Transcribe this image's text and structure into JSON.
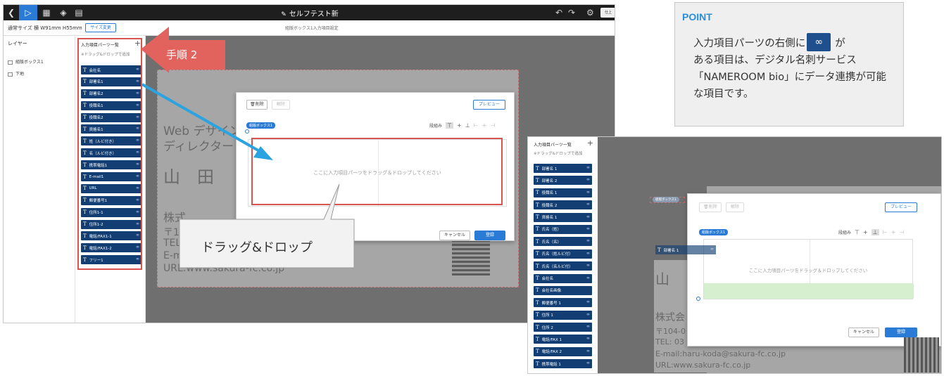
{
  "topbar": {
    "back_icon": "chevron-left-icon",
    "title": "セルフテスト新",
    "mini_button": "仕上"
  },
  "subbar": {
    "size_label": "通常サイズ 横 W91mm H55mm",
    "size_change_button": "サイズ変更",
    "center_title": "組版ボックス1入力項目設定"
  },
  "layers": {
    "title": "レイヤー",
    "items": [
      "組版ボックス1",
      "下地"
    ]
  },
  "parts_panel": {
    "title": "入力項目パーツ一覧",
    "hint": "※ドラッグ&ドロップで追加",
    "items": [
      "会社名",
      "部署名1",
      "部署名2",
      "役職名1",
      "役職名2",
      "資格名1",
      "姓（ルビ付き）",
      "名（ルビ付き）",
      "携帯電話1",
      "E-mail1",
      "URL",
      "郵便番号1",
      "住所1-1",
      "住所1-2",
      "電話/FAX1-1",
      "電話/FAX1-2",
      "フリー1"
    ]
  },
  "card1": {
    "line1": "Web デザイン",
    "line2": "ディレクター",
    "name": "山　田",
    "company": "株式",
    "zip": "〒1",
    "tel": "TEL",
    "email": "E-m",
    "url": "URL:www.sakura-fc.co.jp"
  },
  "modal1": {
    "delete_button": "削除",
    "unlink_button": "解除",
    "preview_button": "プレビュー",
    "box_tag": "組版ボックス1",
    "tools_label": "段組み",
    "dropzone_text": "ここに入力項目パーツをドラッグ＆ドロップしてください",
    "cancel_button": "キャンセル",
    "register_button": "登録"
  },
  "callouts": {
    "step": "手順 2",
    "drag_drop": "ドラッグ&ドロップ"
  },
  "point": {
    "title": "POINT",
    "line1_before": "入力項目パーツの右側に",
    "line1_after": "が",
    "rest": "ある項目は、デジタル名刺サービス「NAMEROOM bio」にデータ連携が可能な項目です。"
  },
  "shot2": {
    "parts_title": "入力項目パーツ一覧",
    "parts_hint": "※ドラッグ&ドロップで追加",
    "items": [
      {
        "label": "部署名 1",
        "linked": true
      },
      {
        "label": "部署名 2",
        "linked": true
      },
      {
        "label": "役職名 1",
        "linked": true
      },
      {
        "label": "役職名 2",
        "linked": true
      },
      {
        "label": "資格名 1",
        "linked": true
      },
      {
        "label": "氏名（姓）",
        "linked": true
      },
      {
        "label": "氏名（名）",
        "linked": true
      },
      {
        "label": "氏名（姓ルビ付）",
        "linked": true
      },
      {
        "label": "氏名（名ルビ付）",
        "linked": true
      },
      {
        "label": "会社名",
        "linked": true
      },
      {
        "label": "会社名画像",
        "linked": false
      },
      {
        "label": "郵便番号 1",
        "linked": true
      },
      {
        "label": "住所 1",
        "linked": true
      },
      {
        "label": "住所 2",
        "linked": true
      },
      {
        "label": "電話/FAX 1",
        "linked": true
      },
      {
        "label": "電話/FAX 2",
        "linked": true
      },
      {
        "label": "携帯電話 1",
        "linked": true
      }
    ],
    "card_tag": "組版ボックス1",
    "dragging_item": "部署名 1",
    "card_name": "山",
    "card_company": "株式会",
    "card_zip": "〒104-0",
    "card_tel": "TEL: 03",
    "card_email": "E-mail:haru-koda@sakura-fc.co.jp",
    "card_url": "URL:www.sakura-fc.co.jp",
    "modal": {
      "delete_button": "削除",
      "unlink_button": "解除",
      "preview_button": "プレビュー",
      "box_tag": "組版ボックス1",
      "tools_label": "段組み",
      "dropzone_text": "ここに入力項目パーツをドラッグ＆ドロップしてください",
      "cancel_button": "キャンセル",
      "register_button": "登録"
    }
  },
  "colors": {
    "accent_blue": "#2a7bd6",
    "part_navy": "#123e73",
    "callout_red": "#e2625e",
    "point_blue": "#2a8fd6",
    "arrow_blue": "#2aa3e0"
  }
}
